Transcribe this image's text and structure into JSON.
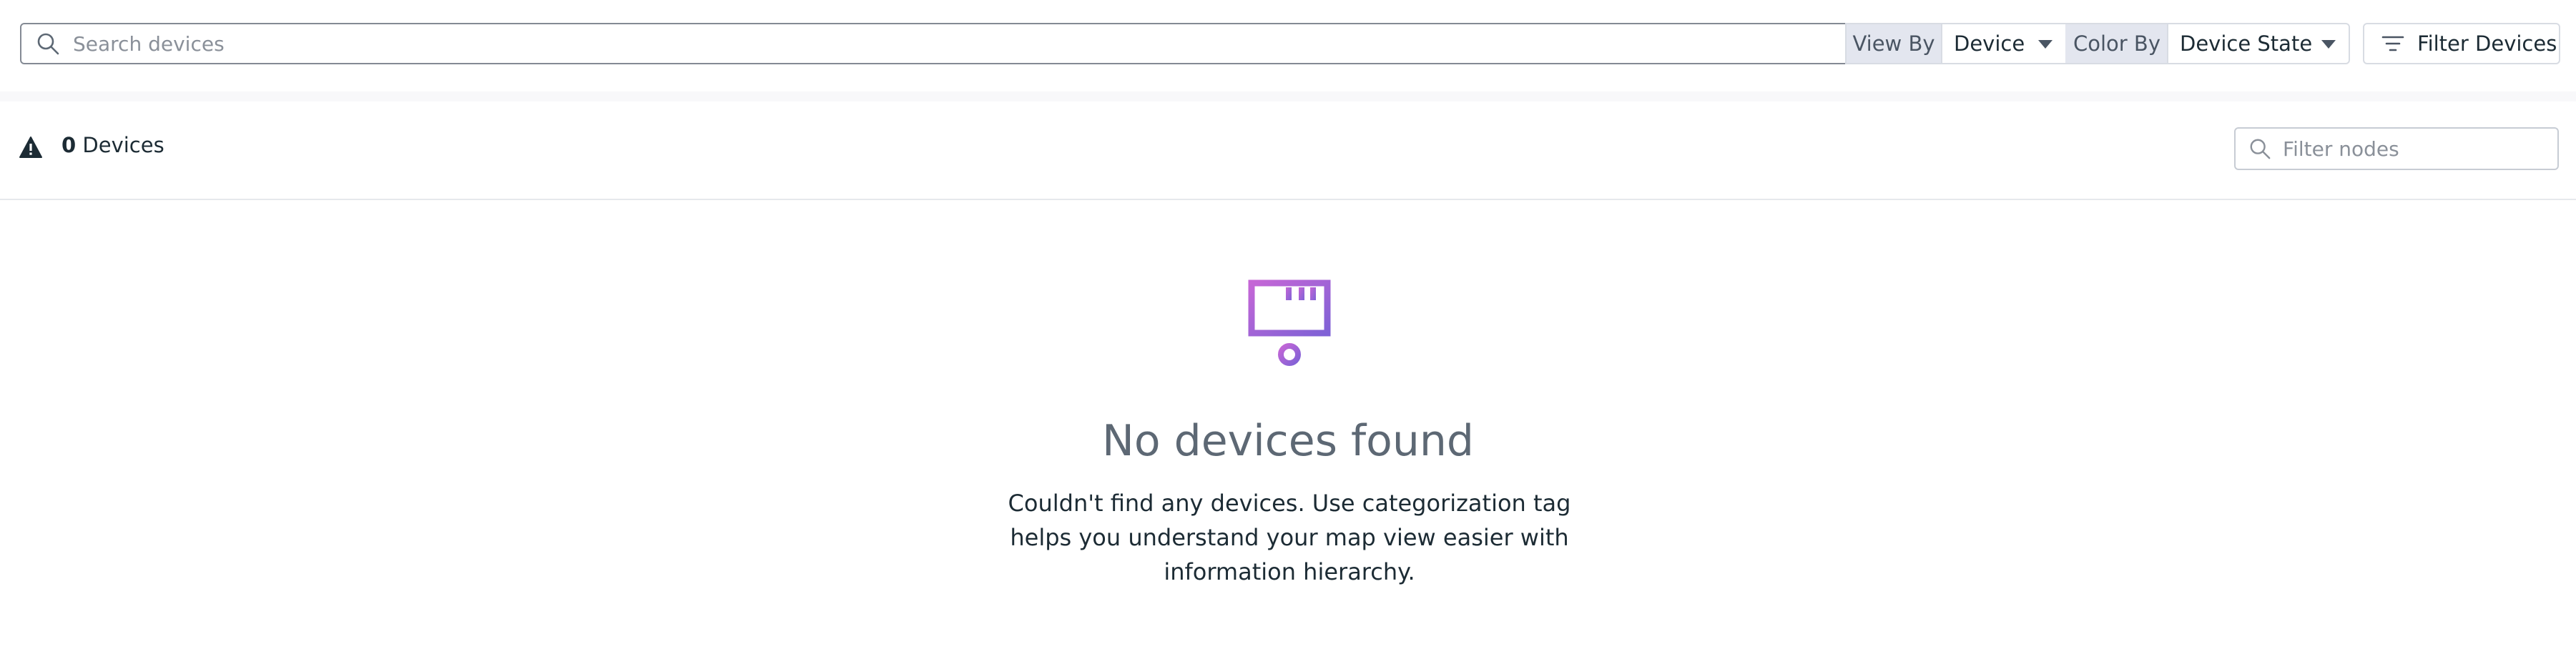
{
  "toolbar": {
    "search_placeholder": "Search devices",
    "view_by_label": "View By",
    "view_by_value": "Device",
    "color_by_label": "Color By",
    "color_by_value": "Device State",
    "filter_button_label": "Filter Devices"
  },
  "summary": {
    "device_count": "0",
    "device_count_suffix": "Devices",
    "node_filter_placeholder": "Filter nodes"
  },
  "empty_state": {
    "title": "No devices found",
    "description": "Couldn't find any devices. Use categorization tag helps you understand your map view easier with information hierarchy."
  },
  "icons": {
    "search": "search-icon",
    "filter": "filter-lines-icon",
    "warning": "warning-icon",
    "empty": "network-device-icon"
  },
  "colors": {
    "accent_top": "#c566d6",
    "accent_bottom": "#7f62d6",
    "addon_bg": "#e3e6ef",
    "title_gray": "#5d6874"
  }
}
